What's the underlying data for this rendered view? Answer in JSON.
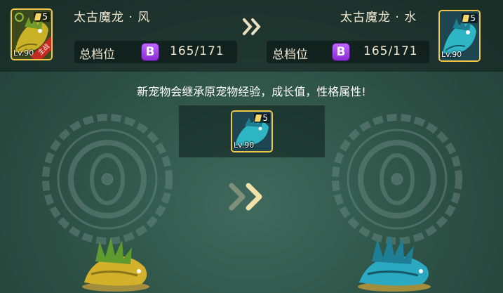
{
  "source_pet": {
    "name": "太古魔龙 · 风",
    "level": "Lv.90",
    "star_count": "5",
    "tag": "主战",
    "grade_label": "总档位",
    "grade": "B",
    "grade_value": "165/171"
  },
  "target_pet": {
    "name": "太古魔龙 · 水",
    "level": "Lv.90",
    "star_count": "5",
    "grade_label": "总档位",
    "grade": "B",
    "grade_value": "165/171"
  },
  "notice": "新宠物会继承原宠物经验，成长值，性格属性!",
  "result_pet": {
    "level": "Lv.90",
    "star_count": "5"
  },
  "colors": {
    "accent_gold": "#f1c64b",
    "grade_purple": "#a847ec",
    "wind_dragon": "#c9b227",
    "water_dragon": "#2fb6c4"
  },
  "icons": [
    "double-chevron-icon",
    "star-ticket-icon",
    "element-ring-icon",
    "rune-medallion-icon"
  ]
}
